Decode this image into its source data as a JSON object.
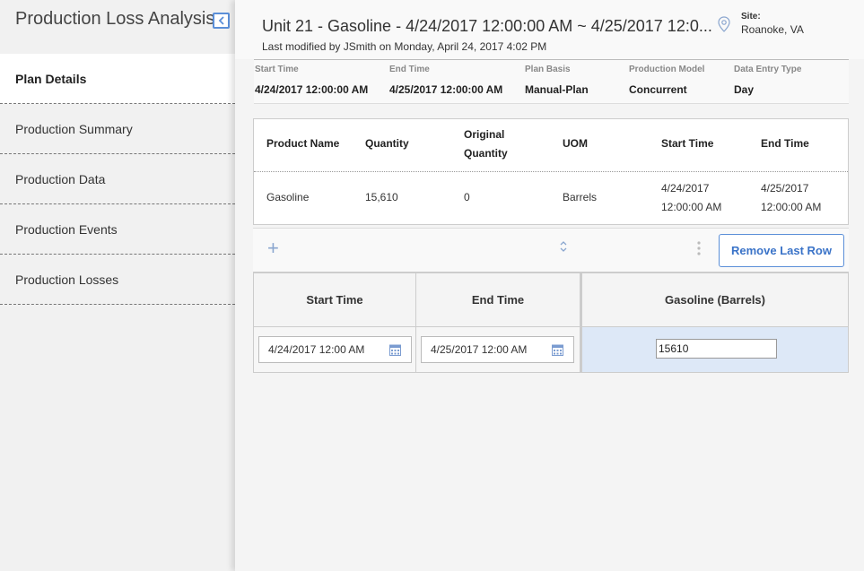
{
  "sidebar": {
    "title": "Production Loss Analysis",
    "items": [
      {
        "label": "Plan Details",
        "active": true
      },
      {
        "label": "Production Summary"
      },
      {
        "label": "Production Data"
      },
      {
        "label": "Production Events"
      },
      {
        "label": "Production Losses"
      }
    ]
  },
  "header": {
    "title": "Unit 21 - Gasoline - 4/24/2017 12:00:00 AM ~ 4/25/2017 12:0...",
    "subtitle": "Last modified by JSmith on Monday, April 24, 2017 4:02 PM",
    "site_label": "Site:",
    "site_value": "Roanoke, VA"
  },
  "details": [
    {
      "label": "Start Time",
      "value": "4/24/2017 12:00:00 AM"
    },
    {
      "label": "End Time",
      "value": "4/25/2017 12:00:00 AM"
    },
    {
      "label": "Plan Basis",
      "value": "Manual-Plan"
    },
    {
      "label": "Production Model",
      "value": "Concurrent"
    },
    {
      "label": "Data Entry Type",
      "value": "Day"
    }
  ],
  "product_table": {
    "headers": [
      "Product Name",
      "Quantity",
      "Original Quantity",
      "UOM",
      "Start Time",
      "End Time"
    ],
    "rows": [
      {
        "product": "Gasoline",
        "quantity": "15,610",
        "original_quantity": "0",
        "uom": "Barrels",
        "start_date": "4/24/2017",
        "start_time": "12:00:00 AM",
        "end_date": "4/25/2017",
        "end_time": "12:00:00 AM"
      }
    ]
  },
  "toolbar": {
    "remove_label": "Remove Last Row"
  },
  "entry_grid": {
    "headers": [
      "Start Time",
      "End Time",
      "Gasoline (Barrels)"
    ],
    "row": {
      "start": "4/24/2017 12:00 AM",
      "end": "4/25/2017 12:00 AM",
      "value": "15610"
    }
  },
  "colors": {
    "accent": "#3a73c8",
    "selected_row": "#dde8f7"
  }
}
